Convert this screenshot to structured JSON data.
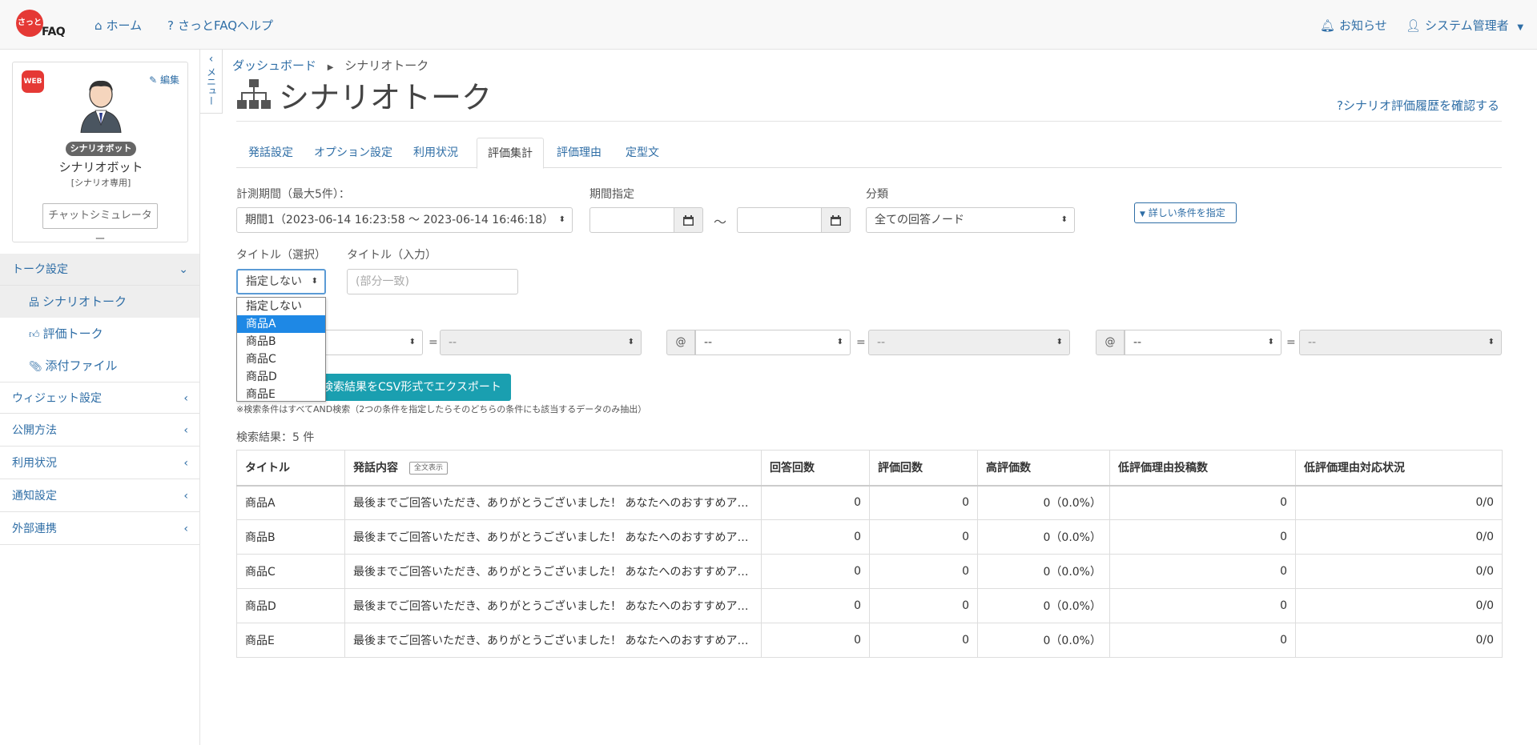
{
  "header": {
    "logo_text": "さっと",
    "logo_suffix": "FAQ",
    "home": "ホーム",
    "help": "さっとFAQヘルプ",
    "notifications": "お知らせ",
    "user": "システム管理者"
  },
  "profile": {
    "badge": "WEB",
    "edit": "編集",
    "tag": "シナリオボット",
    "name": "シナリオボット",
    "sub": "[シナリオ専用]",
    "simulator": "チャットシミュレーター"
  },
  "sidebar": {
    "talk_settings": "トーク設定",
    "sub_items": [
      "シナリオトーク",
      "評価トーク",
      "添付ファイル"
    ],
    "sections": [
      "ウィジェット設定",
      "公開方法",
      "利用状況",
      "通知設定",
      "外部連携"
    ]
  },
  "menu_toggle": "メニュー",
  "breadcrumb": {
    "home": "ダッシュボード",
    "current": "シナリオトーク"
  },
  "page_title": "シナリオトーク",
  "help_link": "シナリオ評価履歴を確認する",
  "tabs": [
    "発話設定",
    "オプション設定",
    "利用状況",
    "評価集計",
    "評価理由",
    "定型文"
  ],
  "active_tab": "評価集計",
  "filters": {
    "period_label": "計測期間（最大5件）：",
    "period_value": "期間1（2023-06-14 16:23:58 〜 2023-06-14 16:46:18）",
    "range_label": "期間指定",
    "range_sep": "〜",
    "category_label": "分類",
    "category_value": "全ての回答ノード",
    "detail_btn": "詳しい条件を指定",
    "title_select_label": "タイトル（選択）",
    "title_select_value": "指定しない",
    "title_input_label": "タイトル（入力）",
    "title_input_placeholder": "(部分一致)",
    "at": "@",
    "eq": "=",
    "cond_value": "--"
  },
  "dropdown_options": [
    "指定しない",
    "商品A",
    "商品B",
    "商品C",
    "商品D",
    "商品E"
  ],
  "dropdown_highlight": "商品A",
  "export_btn": "検索結果をCSV形式でエクスポート",
  "note": "※検索条件はすべてAND検索（2つの条件を指定したらそのどちらの条件にも該当するデータのみ抽出）",
  "result_count": "検索結果：5 件",
  "table": {
    "headers": [
      "タイトル",
      "発話内容",
      "回答回数",
      "評価回数",
      "高評価数",
      "低評価理由投稿数",
      "低評価理由対応状況"
    ],
    "fulltext": "全文表示",
    "rows": [
      [
        "商品A",
        "最後までご回答いただき、ありがとうございました！ あなたへのおすすめア…",
        "0",
        "0",
        "0（0.0%）",
        "0",
        "0/0"
      ],
      [
        "商品B",
        "最後までご回答いただき、ありがとうございました！ あなたへのおすすめア…",
        "0",
        "0",
        "0（0.0%）",
        "0",
        "0/0"
      ],
      [
        "商品C",
        "最後までご回答いただき、ありがとうございました！ あなたへのおすすめア…",
        "0",
        "0",
        "0（0.0%）",
        "0",
        "0/0"
      ],
      [
        "商品D",
        "最後までご回答いただき、ありがとうございました！ あなたへのおすすめア…",
        "0",
        "0",
        "0（0.0%）",
        "0",
        "0/0"
      ],
      [
        "商品E",
        "最後までご回答いただき、ありがとうございました！ あなたへのおすすめア…",
        "0",
        "0",
        "0（0.0%）",
        "0",
        "0/0"
      ]
    ]
  },
  "colors": {
    "brand": "#e53935",
    "link": "#2f6ea6",
    "export": "#1a9fb0",
    "highlight": "#1e88e5"
  }
}
